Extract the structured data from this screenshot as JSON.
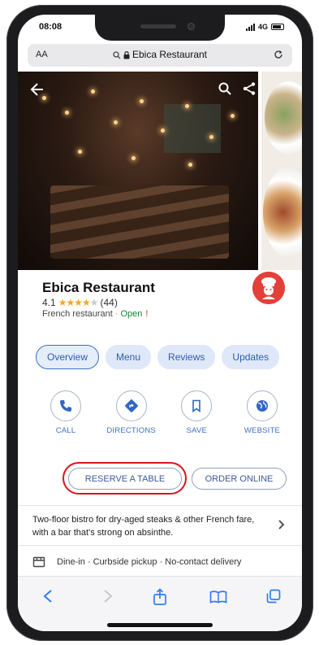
{
  "status_bar": {
    "time": "08:08",
    "network": "4G"
  },
  "browser": {
    "text_size_label": "AA",
    "url_title": "Ebica Restaurant"
  },
  "place": {
    "name": "Ebica Restaurant",
    "rating": "4.1",
    "stars_filled": 4,
    "review_count": "(44)",
    "category": "French restaurant",
    "separator": "·",
    "open_status": "Open",
    "alert_mark": "!",
    "description": "Two-floor bistro for dry-aged steaks & other French fare, with a bar that's strong on absinthe.",
    "services": "Dine-in · Curbside pickup · No-contact delivery"
  },
  "tabs": [
    {
      "label": "Overview",
      "active": true
    },
    {
      "label": "Menu",
      "active": false
    },
    {
      "label": "Reviews",
      "active": false
    },
    {
      "label": "Updates",
      "active": false
    }
  ],
  "actions": [
    {
      "label": "CALL",
      "icon": "phone-icon"
    },
    {
      "label": "DIRECTIONS",
      "icon": "directions-icon"
    },
    {
      "label": "SAVE",
      "icon": "bookmark-icon"
    },
    {
      "label": "WEBSITE",
      "icon": "globe-icon"
    }
  ],
  "buttons": {
    "reserve": "RESERVE A TABLE",
    "order": "ORDER ONLINE"
  },
  "colors": {
    "accent": "#3d6fc4",
    "highlight": "#d8141c",
    "star": "#f5a623",
    "open": "#188038"
  }
}
